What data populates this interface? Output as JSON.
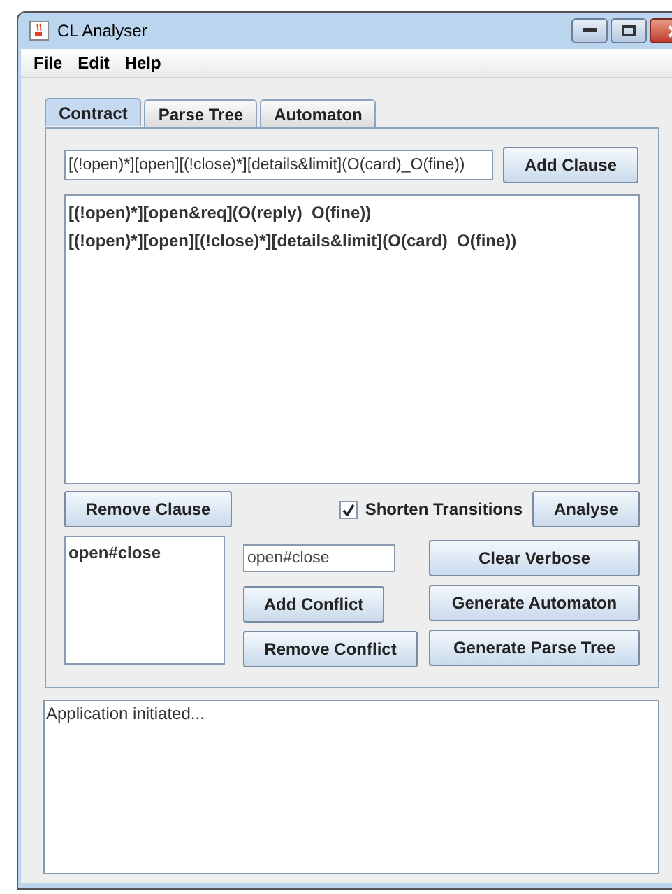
{
  "window": {
    "title": "CL Analyser"
  },
  "menu": [
    "File",
    "Edit",
    "Help"
  ],
  "tabs": [
    {
      "label": "Contract",
      "selected": true
    },
    {
      "label": "Parse Tree",
      "selected": false
    },
    {
      "label": "Automaton",
      "selected": false
    }
  ],
  "clause_input": {
    "value": "[(!open)*][open][(!close)*][details&limit](O(card)_O(fine))"
  },
  "add_clause_button": "Add Clause",
  "clauses": [
    "[(!open)*][open&req](O(reply)_O(fine))",
    "[(!open)*][open][(!close)*][details&limit](O(card)_O(fine))"
  ],
  "remove_clause_button": "Remove Clause",
  "shorten_transitions": {
    "label": "Shorten Transitions",
    "checked": true
  },
  "analyse_button": "Analyse",
  "conflicts": [
    "open#close"
  ],
  "conflict_input": {
    "value": "open#close"
  },
  "buttons": [
    {
      "label": "Clear Verbose",
      "kind": "right"
    },
    {
      "label": "Add Conflict",
      "kind": "left"
    },
    {
      "label": "Generate Automaton",
      "kind": "right"
    },
    {
      "label": "Remove Conflict",
      "kind": "left"
    },
    {
      "label": "Generate Parse Tree",
      "kind": "right"
    }
  ],
  "log": [
    "Application initiated..."
  ]
}
